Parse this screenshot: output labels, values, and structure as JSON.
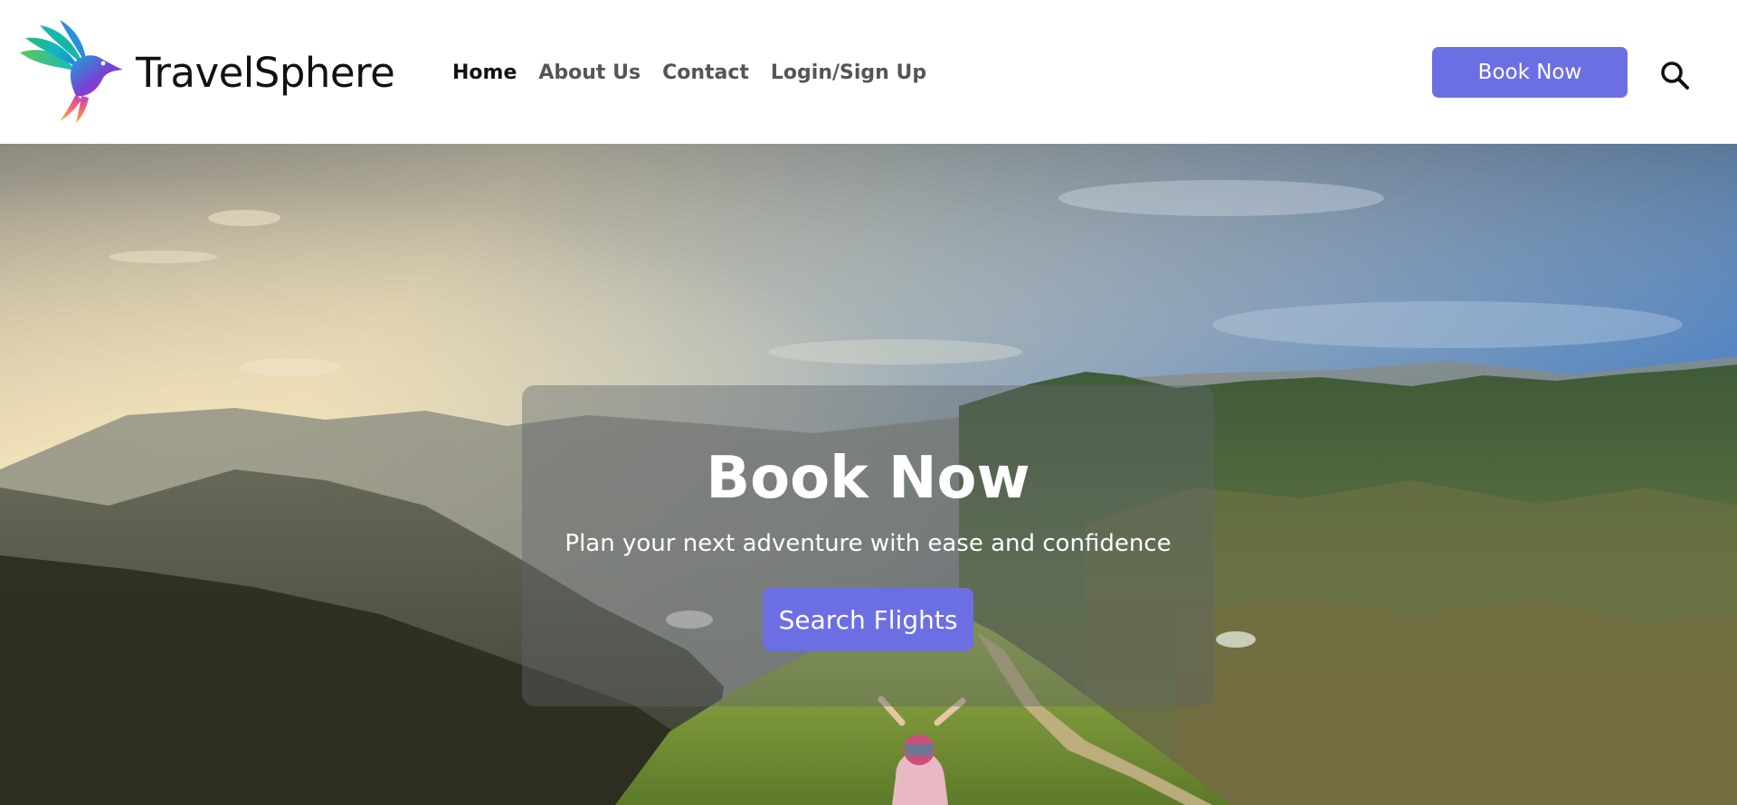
{
  "header": {
    "logo_icon": "hummingbird-logo-icon",
    "brand": "TravelSphere",
    "nav": [
      {
        "label": "Home",
        "active": true
      },
      {
        "label": "About Us"
      },
      {
        "label": "Contact"
      },
      {
        "label": "Login/Sign Up"
      }
    ],
    "book_button": "Book Now",
    "search_icon": "search-icon"
  },
  "hero": {
    "background": "mountain-landscape-photo",
    "title": "Book Now",
    "subtitle": "Plan your next adventure with ease and confidence",
    "cta": "Search Flights"
  },
  "colors": {
    "accent": "#6c6fe4",
    "header_bg": "#ffffff",
    "text_dark": "#111111",
    "nav_text": "#555555"
  }
}
